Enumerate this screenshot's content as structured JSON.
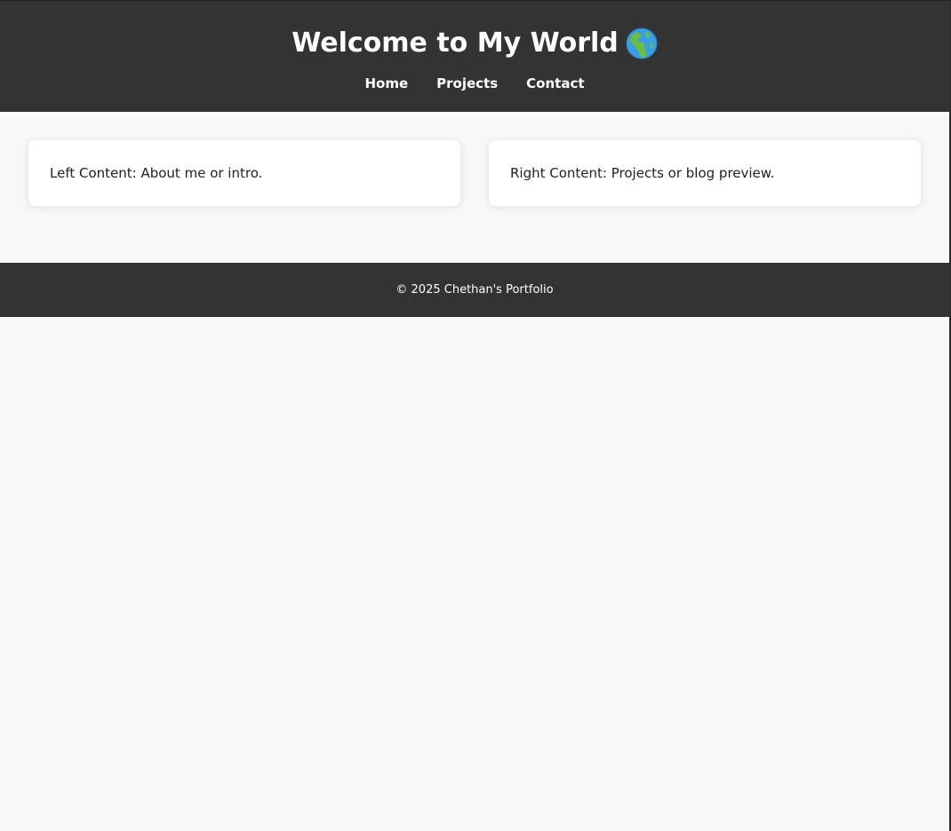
{
  "header": {
    "title": "Welcome to My World",
    "title_icon": "globe-europe-africa-icon",
    "nav": [
      {
        "label": "Home"
      },
      {
        "label": "Projects"
      },
      {
        "label": "Contact"
      }
    ]
  },
  "main": {
    "left_card": "Left Content: About me or intro.",
    "right_card": "Right Content: Projects or blog preview."
  },
  "footer": {
    "text": "© 2025 Chethan's Portfolio"
  },
  "colors": {
    "header_bg": "#333333",
    "page_bg": "#f8f8f8",
    "card_bg": "#ffffff",
    "text_light": "#ffffff",
    "text_dark": "#222222"
  }
}
